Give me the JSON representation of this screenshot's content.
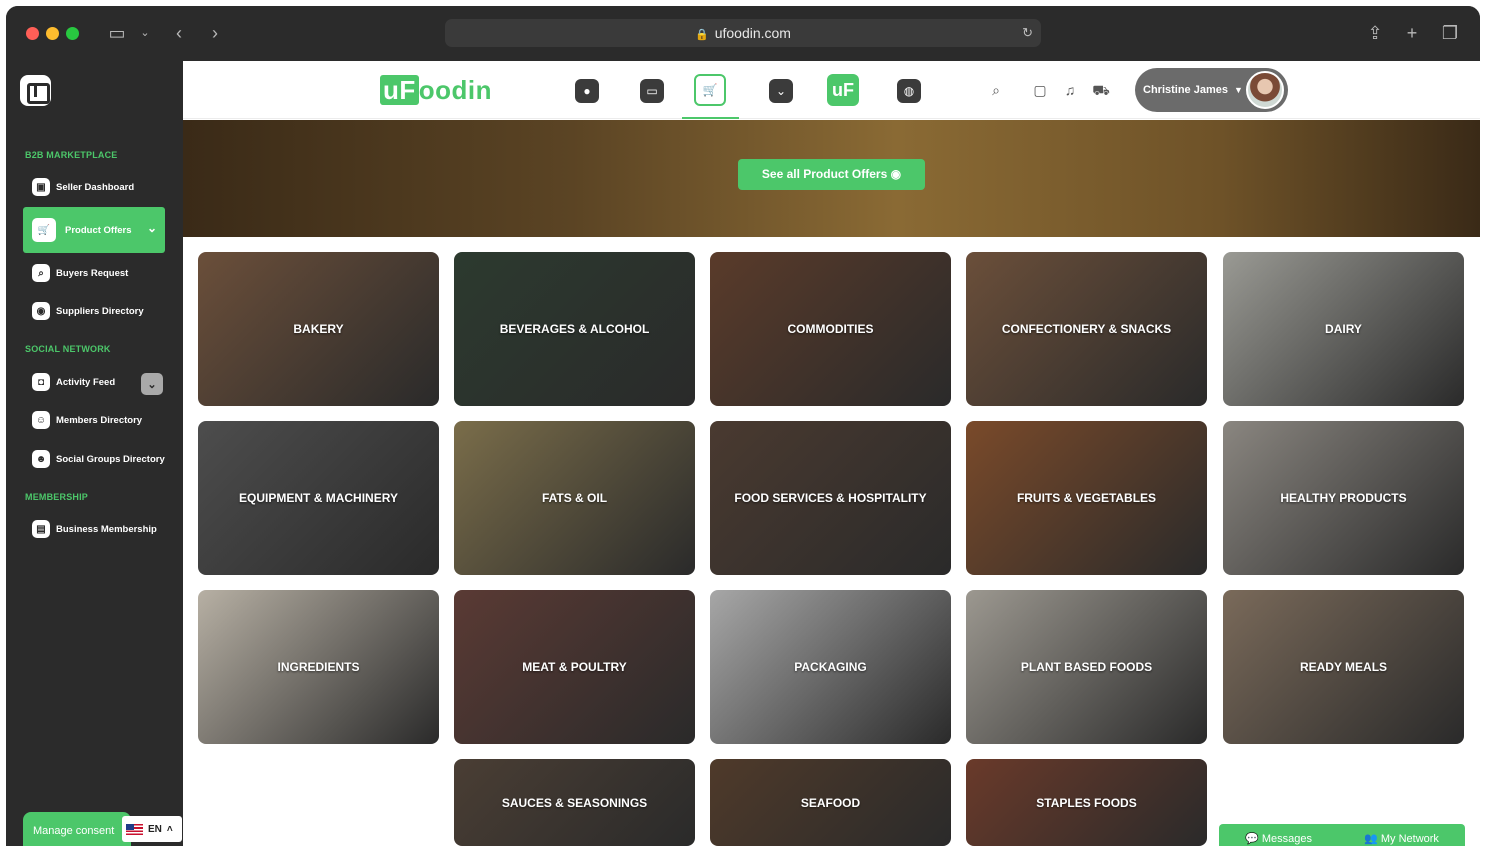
{
  "browser": {
    "url": "ufoodin.com"
  },
  "sidebar": {
    "sections": [
      {
        "title": "B2B MARKETPLACE"
      },
      {
        "title": "SOCIAL NETWORK"
      },
      {
        "title": "MEMBERSHIP"
      }
    ],
    "items": [
      {
        "label": "Seller Dashboard",
        "icon": "monitor-icon"
      },
      {
        "label": "Product Offers",
        "icon": "cart-icon",
        "active": true
      },
      {
        "label": "Buyers Request",
        "icon": "search-icon"
      },
      {
        "label": "Suppliers Directory",
        "icon": "directory-icon"
      },
      {
        "label": "Activity Feed",
        "icon": "feed-icon"
      },
      {
        "label": "Members Directory",
        "icon": "members-icon"
      },
      {
        "label": "Social Groups Directory",
        "icon": "groups-icon"
      },
      {
        "label": "Business Membership",
        "icon": "membership-icon"
      }
    ],
    "consent_label": "Manage consent",
    "language": "EN"
  },
  "topnav": {
    "brand_prefix": "uF",
    "brand_suffix": "oodin",
    "center_badge": "uF",
    "user_name": "Christine James"
  },
  "hero": {
    "button_label": "See all Product Offers"
  },
  "categories": [
    {
      "label": "BAKERY",
      "color": "#6b4f3a"
    },
    {
      "label": "BEVERAGES & ALCOHOL",
      "color": "#2c3a2f"
    },
    {
      "label": "COMMODITIES",
      "color": "#5a3b2a"
    },
    {
      "label": "CONFECTIONERY & SNACKS",
      "color": "#6b4f3a"
    },
    {
      "label": "DAIRY",
      "color": "#9a9a94"
    },
    {
      "label": "EQUIPMENT & MACHINERY",
      "color": "#4d4d4d"
    },
    {
      "label": "FATS & OIL",
      "color": "#7a6d4a"
    },
    {
      "label": "FOOD SERVICES & HOSPITALITY",
      "color": "#4a3a30"
    },
    {
      "label": "FRUITS & VEGETABLES",
      "color": "#7a4a2a"
    },
    {
      "label": "HEALTHY PRODUCTS",
      "color": "#8a8680"
    },
    {
      "label": "INGREDIENTS",
      "color": "#b7b0a4"
    },
    {
      "label": "MEAT & POULTRY",
      "color": "#5a3a34"
    },
    {
      "label": "PACKAGING",
      "color": "#a7a7a7"
    },
    {
      "label": "PLANT BASED FOODS",
      "color": "#9c9890"
    },
    {
      "label": "READY MEALS",
      "color": "#7a6a5a"
    },
    {
      "label": "SAUCES & SEASONINGS",
      "color": "#4a3e34"
    },
    {
      "label": "SEAFOOD",
      "color": "#4f3a2a"
    },
    {
      "label": "STAPLES FOODS",
      "color": "#6a3a2a"
    }
  ],
  "chat": {
    "messages": "Messages",
    "network": "My Network"
  }
}
